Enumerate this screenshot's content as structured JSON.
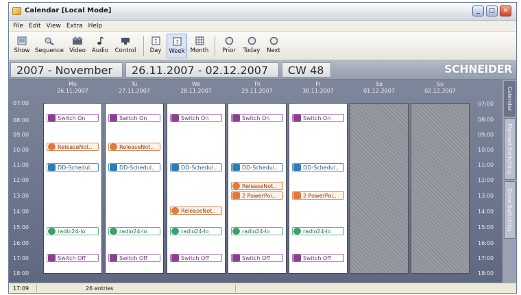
{
  "window": {
    "title": "Calendar [Local Mode]",
    "controls": {
      "minimize": "_",
      "maximize": "□",
      "close": "✕"
    }
  },
  "menu": [
    "File",
    "Edit",
    "View",
    "Extra",
    "Help"
  ],
  "toolbar": [
    {
      "label": "Show",
      "icon": "show-icon"
    },
    {
      "label": "Sequence",
      "icon": "sequence-icon"
    },
    {
      "label": "Video",
      "icon": "video-icon"
    },
    {
      "label": "Audio",
      "icon": "audio-icon"
    },
    {
      "label": "Control",
      "icon": "control-icon"
    },
    {
      "label": "Day",
      "icon": "day-icon"
    },
    {
      "label": "Week",
      "icon": "week-icon",
      "active": true
    },
    {
      "label": "Month",
      "icon": "month-icon"
    },
    {
      "label": "Prior",
      "icon": "prior-icon"
    },
    {
      "label": "Today",
      "icon": "today-icon"
    },
    {
      "label": "Next",
      "icon": "next-icon"
    }
  ],
  "header": {
    "month": "2007 - November",
    "range": "26.11.2007 - 02.12.2007",
    "week": "CW 48",
    "brand": "SCHNEIDER"
  },
  "days": [
    {
      "name": "Mo",
      "date": "26.11.2007",
      "weekend": false
    },
    {
      "name": "Tu",
      "date": "27.11.2007",
      "weekend": false
    },
    {
      "name": "We",
      "date": "28.11.2007",
      "weekend": false
    },
    {
      "name": "Th",
      "date": "29.11.2007",
      "weekend": false
    },
    {
      "name": "Fr",
      "date": "30.11.2007",
      "weekend": false
    },
    {
      "name": "Sa",
      "date": "01.12.2007",
      "weekend": true
    },
    {
      "name": "Su",
      "date": "02.12.2007",
      "weekend": true
    }
  ],
  "times_left": [
    "07:00",
    "08:00",
    "09:00",
    "10:00",
    "11:00",
    "12:00",
    "13:00",
    "14:00",
    "15:00",
    "16:00",
    "17:00",
    "18:00"
  ],
  "times_right": [
    "07:00",
    "08:00",
    "09:00",
    "10:00",
    "11:00",
    "12:00",
    "13:00",
    "14:00",
    "15:00",
    "16:00",
    "17:00",
    "18:00"
  ],
  "entries": {
    "switch_on": "Switch On",
    "release_notes": "ReleaseNot..",
    "dd_schedule": "DD-Schedul..",
    "power_points": "2 PowerPoi..",
    "radio": "radio24-lo",
    "switch_off": "Switch Off"
  },
  "vertical_tabs": [
    "Calendar",
    "Planned Switching",
    "Done Switching"
  ],
  "status": {
    "time": "17:09",
    "entries": "26 entries"
  }
}
